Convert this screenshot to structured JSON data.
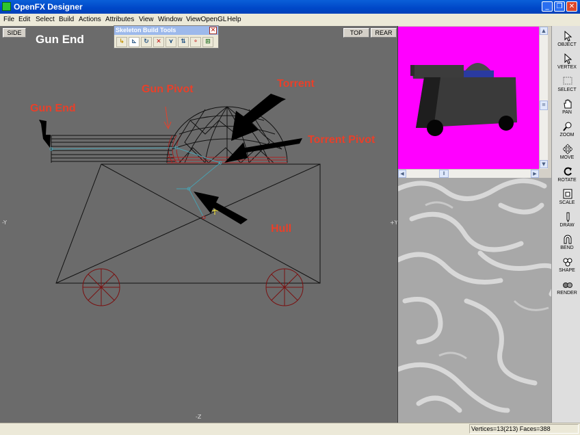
{
  "window": {
    "title": "OpenFX Designer"
  },
  "menu": [
    "File",
    "Edit",
    "Select",
    "Build",
    "Actions",
    "Attributes",
    "View",
    "Window",
    "ViewOpenGL",
    "Help"
  ],
  "viewport": {
    "view_buttons": {
      "side": "SIDE",
      "top": "TOP",
      "rear": "REAR"
    },
    "axis_labels": {
      "left": "-Y",
      "right": "+Y",
      "bottom": "-Z"
    },
    "annotations": {
      "gun_end_heading": "Gun End",
      "gun_end": "Gun End",
      "gun_pivot": "Gun Pivot",
      "torrent": "Torrent",
      "torrent_pivot": "Torrent Pivot",
      "hull": "Hull"
    }
  },
  "skeleton_toolbar": {
    "title": "Skeleton Build Tools",
    "tools": [
      "add-node",
      "edit-node",
      "rotate-node",
      "delete-node",
      "pivot-node",
      "move-node",
      "link-node",
      "select-node"
    ]
  },
  "toolbox": [
    {
      "label": "OBJECT",
      "icon": "arrow-cursor-icon"
    },
    {
      "label": "VERTEX",
      "icon": "vertex-cursor-icon"
    },
    {
      "label": "SELECT",
      "icon": "select-icon"
    },
    {
      "label": "PAN",
      "icon": "hand-icon"
    },
    {
      "label": "ZOOM",
      "icon": "magnifier-icon"
    },
    {
      "label": "MOVE",
      "icon": "move-arrows-icon"
    },
    {
      "label": "ROTATE",
      "icon": "rotate-icon"
    },
    {
      "label": "SCALE",
      "icon": "scale-icon"
    },
    {
      "label": "DRAW",
      "icon": "pencil-icon"
    },
    {
      "label": "BEND",
      "icon": "magnet-icon"
    },
    {
      "label": "SHAPE",
      "icon": "shapes-icon"
    },
    {
      "label": "RENDER",
      "icon": "render-spheres-icon"
    }
  ],
  "status": {
    "text": "Vertices=13(213) Faces=388"
  },
  "colors": {
    "preview_background": "#ff00ff",
    "annotation": "#e8402a",
    "viewport": "#6b6b6b"
  }
}
